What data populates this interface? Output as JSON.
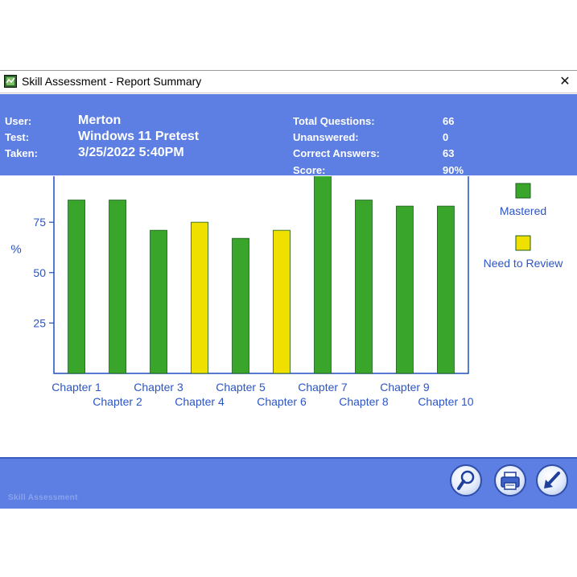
{
  "window": {
    "title": "Skill Assessment - Report Summary",
    "close_symbol": "✕"
  },
  "summary": {
    "user_label": "User:",
    "user_value": "Merton",
    "test_label": "Test:",
    "test_value": "Windows 11 Pretest",
    "taken_label": "Taken:",
    "taken_value": "3/25/2022 5:40PM",
    "total_label": "Total Questions:",
    "total_value": "66",
    "unanswered_label": "Unanswered:",
    "unanswered_value": "0",
    "correct_label": "Correct Answers:",
    "correct_value": "63",
    "score_label": "Score:",
    "score_value": "90%"
  },
  "chart_data": {
    "type": "bar",
    "ylabel": "%",
    "ylim": [
      0,
      105
    ],
    "yticks": [
      25,
      50,
      75,
      100
    ],
    "grid": false,
    "legend_position": "right",
    "categories": [
      "Chapter 1",
      "Chapter 2",
      "Chapter 3",
      "Chapter 4",
      "Chapter 5",
      "Chapter 6",
      "Chapter 7",
      "Chapter 8",
      "Chapter 9",
      "Chapter 10"
    ],
    "values": [
      86,
      86,
      71,
      75,
      67,
      71,
      100,
      86,
      83,
      83
    ],
    "status": [
      "Mastered",
      "Mastered",
      "Mastered",
      "Need to Review",
      "Mastered",
      "Need to Review",
      "Mastered",
      "Mastered",
      "Mastered",
      "Mastered"
    ],
    "legend": [
      {
        "name": "Mastered",
        "color": "#3aa52b"
      },
      {
        "name": "Need to Review",
        "color": "#f0e000"
      }
    ]
  },
  "colors": {
    "header_bg": "#5d7ee2",
    "mastered": "#3aa52b",
    "review": "#f0e000",
    "axis": "#1f4fc2",
    "label_text": "#2c55c6"
  },
  "footer": {
    "brand": "Skill Assessment",
    "buttons": [
      {
        "icon": "magnifier-icon"
      },
      {
        "icon": "printer-icon"
      },
      {
        "icon": "arrow-icon"
      }
    ]
  }
}
